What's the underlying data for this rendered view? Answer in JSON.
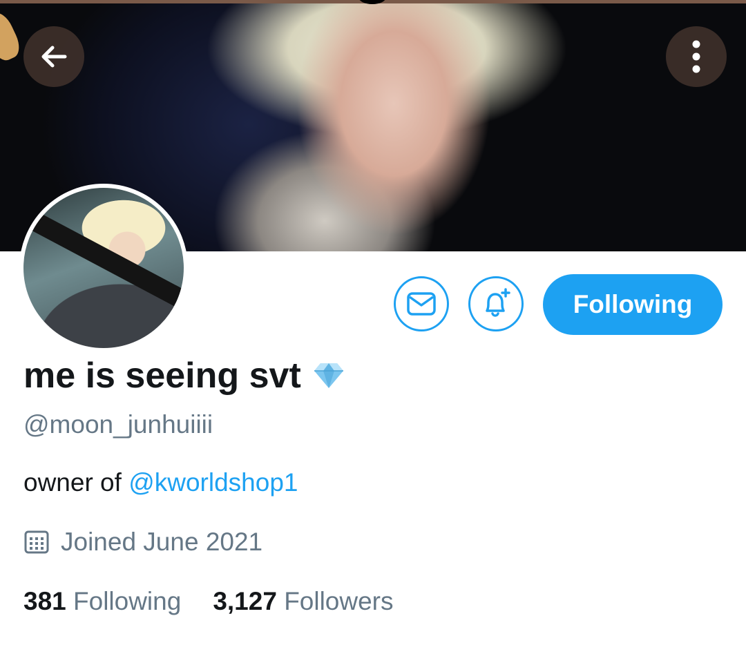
{
  "header": {
    "back_icon": "arrow-left-icon",
    "more_icon": "more-vertical-icon"
  },
  "profile": {
    "display_name": "me is seeing svt",
    "name_emoji": "diamond-icon",
    "handle": "@moon_junhuiiii",
    "bio_prefix": "owner of ",
    "bio_mention": "@kworldshop1",
    "joined_icon": "calendar-icon",
    "joined": "Joined June 2021"
  },
  "actions": {
    "message_icon": "mail-icon",
    "notify_icon": "bell-plus-icon",
    "follow_label": "Following"
  },
  "stats": {
    "following_count": "381",
    "following_label": "Following",
    "followers_count": "3,127",
    "followers_label": "Followers"
  },
  "colors": {
    "accent": "#1da1f2",
    "text_primary": "#14171a",
    "text_secondary": "#657786"
  }
}
